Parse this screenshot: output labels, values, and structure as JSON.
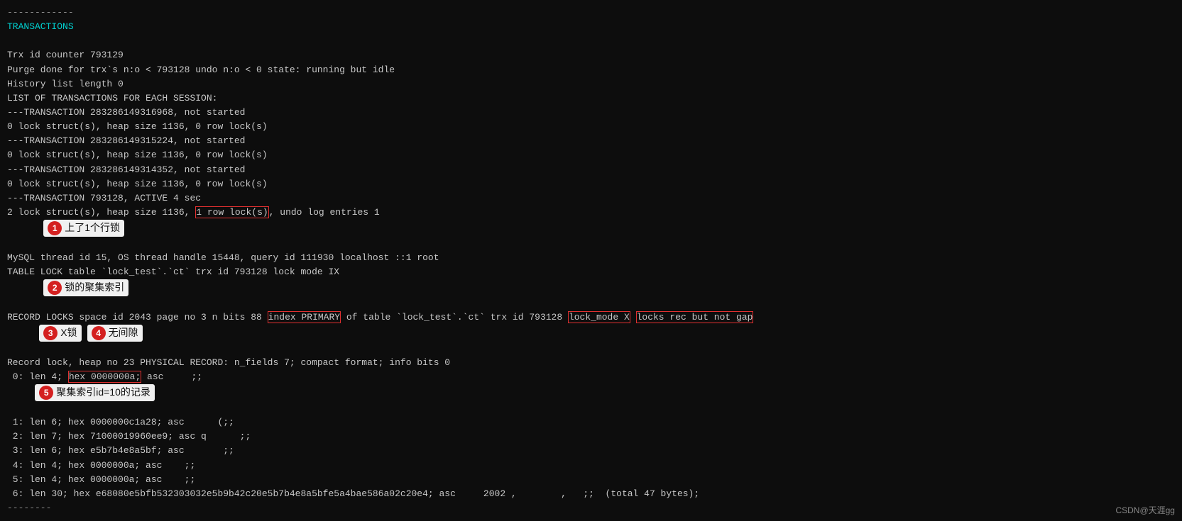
{
  "terminal": {
    "lines": [
      {
        "id": "l0",
        "text": "------------",
        "type": "dashes"
      },
      {
        "id": "l1",
        "text": "TRANSACTIONS",
        "type": "keyword"
      },
      {
        "id": "l2",
        "text": "",
        "type": "normal"
      },
      {
        "id": "l3",
        "text": "Trx id counter 793129",
        "type": "normal"
      },
      {
        "id": "l4",
        "text": "Purge done for trx's n:o < 793128 undo n:o < 0 state: running but idle",
        "type": "normal"
      },
      {
        "id": "l5",
        "text": "History list length 0",
        "type": "normal"
      },
      {
        "id": "l6",
        "text": "LIST OF TRANSACTIONS FOR EACH SESSION:",
        "type": "normal"
      },
      {
        "id": "l7",
        "text": "---TRANSACTION 283286149316968, not started",
        "type": "normal"
      },
      {
        "id": "l8",
        "text": "0 lock struct(s), heap size 1136, 0 row lock(s)",
        "type": "normal"
      },
      {
        "id": "l9",
        "text": "---TRANSACTION 283286149315224, not started",
        "type": "normal"
      },
      {
        "id": "l10",
        "text": "0 lock struct(s), heap size 1136, 0 row lock(s)",
        "type": "normal"
      },
      {
        "id": "l11",
        "text": "---TRANSACTION 283286149314352, not started",
        "type": "normal"
      },
      {
        "id": "l12",
        "text": "0 lock struct(s), heap size 1136, 0 row lock(s)",
        "type": "normal"
      },
      {
        "id": "l13",
        "text": "---TRANSACTION 793128, ACTIVE 4 sec",
        "type": "normal"
      },
      {
        "id": "l14",
        "text": "2 lock struct(s), heap size 1136, 1 row lock(s), undo log entries 1",
        "type": "normal"
      },
      {
        "id": "l15",
        "text": "MySQL thread id 15, OS thread handle 15448, query id 111930 localhost ::1 root",
        "type": "normal"
      },
      {
        "id": "l16",
        "text": "TABLE LOCK table `lock_test`.`ct` trx id 793128 lock mode IX",
        "type": "normal"
      },
      {
        "id": "l17",
        "text": "RECORD LOCKS space id 2043 page no 3 n bits 88 index PRIMARY of table `lock_test`.`ct` trx id 793128 lock_mode X locks rec but not gap",
        "type": "normal"
      },
      {
        "id": "l18",
        "text": "Record lock, heap no 23 PHYSICAL RECORD: n_fields 7; compact format; info bits 0",
        "type": "normal"
      },
      {
        "id": "l19",
        "text": " 0: len 4; hex 0000000a; asc     ;;",
        "type": "normal"
      },
      {
        "id": "l20",
        "text": " 1: len 6; hex 0000000c1a28; asc      (;;",
        "type": "normal"
      },
      {
        "id": "l21",
        "text": " 2: len 7; hex 71000019960ee9; asc q      ;;",
        "type": "normal"
      },
      {
        "id": "l22",
        "text": " 3: len 6; hex e5b7b4e8a5bf; asc       ;;",
        "type": "normal"
      },
      {
        "id": "l23",
        "text": " 4: len 4; hex 0000000a; asc    ;;",
        "type": "normal"
      },
      {
        "id": "l24",
        "text": " 5: len 4; hex 0000000a; asc    ;;",
        "type": "normal"
      },
      {
        "id": "l25",
        "text": " 6: len 30; hex e68080e5bfb532303032e5b9b42c20e5b7b4e8a5bfe5a4bae586a02c20e4; asc     2002 ,        ,   ;; (total 47 bytes);",
        "type": "normal"
      },
      {
        "id": "l26",
        "text": "--------",
        "type": "dashes"
      }
    ]
  },
  "annotations": {
    "ann1": {
      "num": "1",
      "text": "上了1个行锁"
    },
    "ann2": {
      "num": "2",
      "text": "锁的聚集索引"
    },
    "ann3": {
      "num": "3",
      "text": "X锁"
    },
    "ann4": {
      "num": "4",
      "text": "无间隙"
    },
    "ann5": {
      "num": "5",
      "text": "聚集索引id=10的记录"
    }
  },
  "csdn_badge": "CSDN@天涯gg"
}
